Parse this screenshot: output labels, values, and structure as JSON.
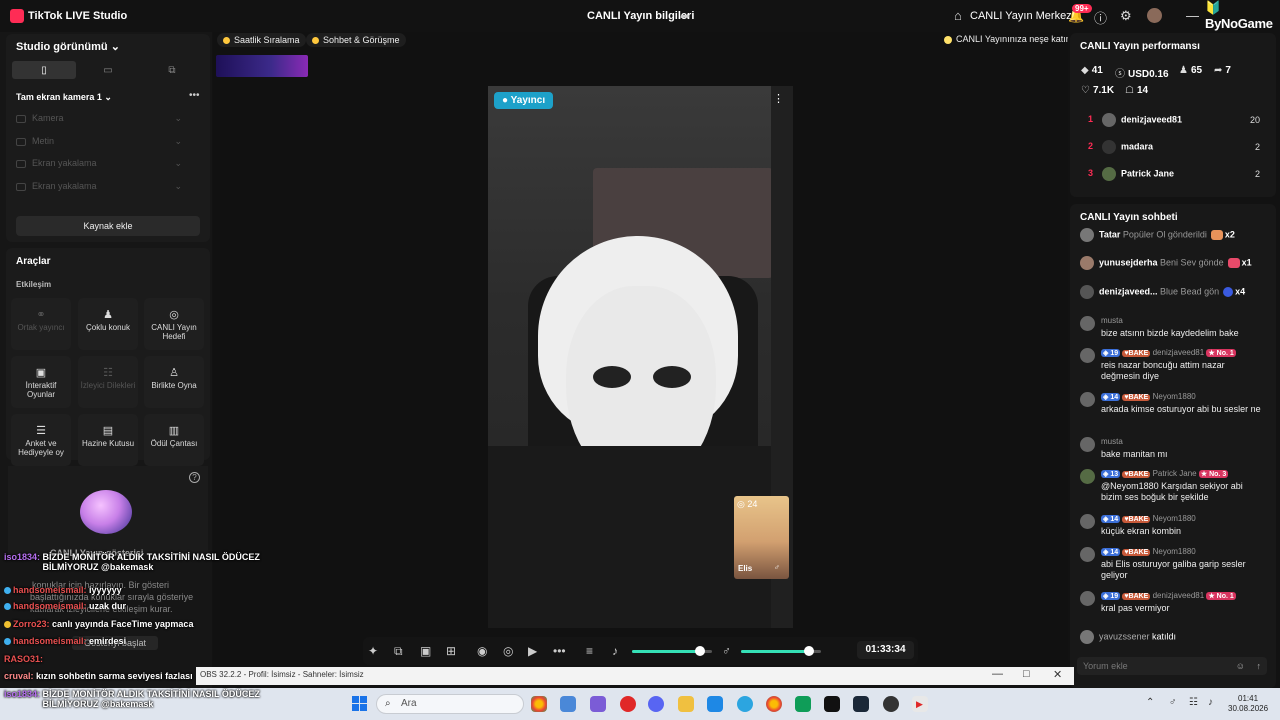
{
  "titlebar": {
    "app_title": "TikTok LIVE Studio",
    "center_title": "CANLI Yayın bilgileri",
    "live_center": "CANLI Yayın Merkezi",
    "notif_badge": "99+",
    "brand": "ByNoGame"
  },
  "left": {
    "studio_view": "Studio görünümü",
    "scene": "Tam ekran kamera 1",
    "sources": [
      "Kamera",
      "Metin",
      "Ekran yakalama",
      "Ekran yakalama"
    ],
    "add_source": "Kaynak ekle",
    "tools_title": "Araçlar",
    "interaction": "Etkileşim",
    "tools": [
      {
        "label": "Ortak yayıncı",
        "icon": "link-icon"
      },
      {
        "label": "Çoklu konuk",
        "icon": "users-icon"
      },
      {
        "label": "CANLI Yayın Hedefi",
        "icon": "target-icon"
      },
      {
        "label": "İnteraktif Oyunlar",
        "icon": "gamepad-icon"
      },
      {
        "label": "İzleyici Dilekleri",
        "icon": "wish-icon"
      },
      {
        "label": "Birlikte Oyna",
        "icon": "joystick-icon"
      },
      {
        "label": "Anket ve Hediyeyle oy",
        "icon": "poll-icon"
      },
      {
        "label": "Hazine Kutusu",
        "icon": "treasure-icon"
      },
      {
        "label": "Ödül Çantası",
        "icon": "reward-bag-icon"
      }
    ],
    "goal_title": "CANLI Yayın gösterisi",
    "goal_desc_1": "konuklar için hazırlayın. Bir gösteri",
    "goal_desc_2": "başlattığınızda konuklar sırayla gösteriye",
    "goal_desc_3": "katılarak izleyicilerle etkileşim kurar.",
    "goal_button": "Gösteriyi başlat"
  },
  "center": {
    "pill1": "Saatlik Sıralama",
    "pill2": "Sohbet & Görüşme",
    "tip": "CANLI Yayınınıza neşe katın",
    "host_label": "Yayıncı",
    "guest_count": "24",
    "guest_name": "Elis",
    "timer": "01:33:34",
    "volume": 0.85,
    "mic_level": 0.85
  },
  "overlay_chat": [
    {
      "user": "iso1834:",
      "text": "BİZDE MONİTÖR ALDIK TAKSİTİNİ NASIL ÖDÜCEZ BİLMİYORUZ @bakemask"
    },
    {
      "user": "handsomeismail:",
      "text": "iyyyyyy"
    },
    {
      "user": "handsomeismail:",
      "text": "uzak dur"
    },
    {
      "user": "Zorro23:",
      "text": "canlı yayında FaceTime yapmaca"
    },
    {
      "user": "handsomeismail:",
      "text": "emirdesi"
    },
    {
      "user": "RASO31:",
      "text": ""
    },
    {
      "user": "cruval:",
      "text": "kızın sohbetin sarma seviyesi fazlası"
    },
    {
      "user": "iso1834:",
      "text": "BİZDE MONİTÖR ALDIK TAKSİTİNİ NASIL ÖDÜCEZ BİLMİYORUZ @bakemask"
    }
  ],
  "right": {
    "perf_title": "CANLI Yayın performansı",
    "stats": {
      "diamonds": "41",
      "usd": "USD0.16",
      "viewers": "65",
      "shares": "7",
      "likes": "7.1K",
      "gifters": "14"
    },
    "ranking": [
      {
        "rank": "1",
        "name": "denizjaveed81",
        "value": "20"
      },
      {
        "rank": "2",
        "name": "madara",
        "value": "2"
      },
      {
        "rank": "3",
        "name": "Patrick Jane",
        "value": "2"
      }
    ],
    "chat_title": "CANLI Yayın sohbeti",
    "gifts": [
      {
        "user": "Tatar",
        "text": "Popüler Ol gönderildi",
        "count": "x2",
        "color": "#e8935a"
      },
      {
        "user": "yunusejderha",
        "text": "Beni Sev gönde",
        "count": "x1",
        "color": "#e84a6a"
      },
      {
        "user": "denizjaveed...",
        "text": "Blue Bead gön",
        "count": "x4",
        "color": "#3a5adf"
      }
    ],
    "messages": [
      {
        "header": "musta",
        "text": "bize atsınn bizde kaydedelim bake"
      },
      {
        "level": "19",
        "bake": "BAKE",
        "header": "denizjaveed81",
        "no": "No. 1",
        "text": "reis nazar boncuğu attim nazar değmesin diye"
      },
      {
        "level": "14",
        "bake": "BAKE",
        "header": "Neyom1880",
        "text": "arkada kimse osturuyor abi bu sesler ne"
      },
      {
        "header": "musta",
        "text": "bake manitan mı"
      },
      {
        "level": "13",
        "bake": "BAKE",
        "header": "Patrick Jane",
        "no": "No. 3",
        "text": "@Neyom1880 Karşıdan sekiyor abi bizim ses boğuk bir şekilde"
      },
      {
        "level": "14",
        "bake": "BAKE",
        "header": "Neyom1880",
        "text": "küçük ekran kombin"
      },
      {
        "level": "14",
        "bake": "BAKE",
        "header": "Neyom1880",
        "text": "abi Elis osturuyor galiba garip sesler geliyor"
      },
      {
        "level": "19",
        "bake": "BAKE",
        "header": "denizjaveed81",
        "no": "No. 1",
        "text": "kral pas vermiyor"
      }
    ],
    "joined_user": "yavuzssener",
    "joined_text": "katıldı",
    "input_placeholder": "Yorum ekle"
  },
  "window_strip": {
    "title": "OBS 32.2.2 - Profil: İsimsiz - Sahneler: İsimsiz"
  },
  "taskbar": {
    "search": "Ara",
    "time": "01:41",
    "date": "30.08.2026"
  }
}
